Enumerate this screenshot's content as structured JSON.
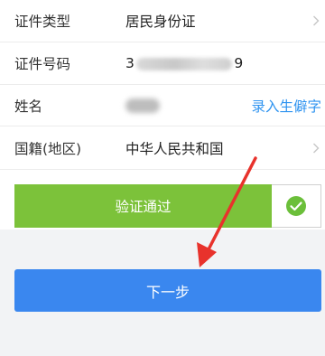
{
  "form": {
    "id_type": {
      "label": "证件类型",
      "value": "居民身份证"
    },
    "id_number": {
      "label": "证件号码",
      "value_prefix": "3",
      "value_suffix": "9"
    },
    "name": {
      "label": "姓名",
      "action_link": "录入生僻字"
    },
    "nationality": {
      "label": "国籍(地区)",
      "value": "中华人民共和国"
    }
  },
  "verify": {
    "status_label": "验证通过"
  },
  "next_button": {
    "label": "下一步"
  },
  "colors": {
    "verify_green": "#7cc23a",
    "next_blue": "#3a87ef",
    "link_blue": "#2e93f0",
    "annotation_arrow": "#e8322c",
    "check_green": "#6bbf3a"
  },
  "icons": {
    "chevron": "chevron-right-icon",
    "check": "check-circle-icon",
    "annotation": "red-arrow-icon"
  }
}
